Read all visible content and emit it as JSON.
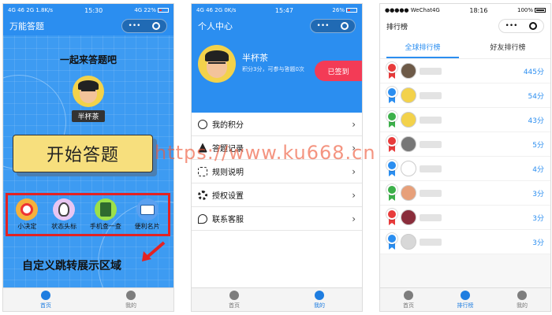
{
  "phone1": {
    "status": {
      "left": "4G 46 2G 1.8K/s",
      "time": "15:30",
      "right": "4G 22%"
    },
    "nav_title": "万能答题",
    "subtitle": "一起来答题吧",
    "nickname": "半杯茶",
    "start_label": "开始答题",
    "tools": [
      {
        "label": "小决定",
        "icon": "wheel-icon",
        "color": "#f5b13c"
      },
      {
        "label": "状态头标",
        "icon": "penguin-icon",
        "color": "#e7c6f2"
      },
      {
        "label": "手机查一查",
        "icon": "notebook-icon",
        "color": "#9be04a"
      },
      {
        "label": "便利名片",
        "icon": "card-icon",
        "color": "#5aa0f0"
      }
    ],
    "custom_text": "自定义跳转展示区域",
    "tabs": [
      {
        "label": "首页",
        "icon": "home-icon"
      },
      {
        "label": "我的",
        "icon": "user-icon"
      }
    ],
    "active_tab": 0
  },
  "phone2": {
    "status": {
      "left": "4G 46 2G 0K/s",
      "time": "15:47",
      "right": "26%"
    },
    "nav_title": "个人中心",
    "nickname": "半杯茶",
    "desc": "积分3分，可参与答题0次",
    "signed_label": "已签到",
    "menu": [
      {
        "label": "我的积分",
        "icon": "coins-icon"
      },
      {
        "label": "答题记录",
        "icon": "record-icon"
      },
      {
        "label": "规则说明",
        "icon": "rules-icon"
      },
      {
        "label": "授权设置",
        "icon": "settings-icon"
      },
      {
        "label": "联系客服",
        "icon": "service-icon"
      }
    ],
    "tabs": [
      {
        "label": "首页",
        "icon": "home-icon"
      },
      {
        "label": "我的",
        "icon": "user-icon"
      }
    ],
    "active_tab": 1
  },
  "phone3": {
    "status": {
      "left": "●●●●● WeChat4G",
      "time": "18:16",
      "right": "100%"
    },
    "nav_title": "排行榜",
    "rank_tabs": [
      "全球排行榜",
      "好友排行榜"
    ],
    "active_rank_tab": 0,
    "rows": [
      {
        "score": "445分",
        "medal": "#e83b3b",
        "avatar": "#6d5a48"
      },
      {
        "score": "54分",
        "medal": "#2b8ef0",
        "avatar": "#f3d24b"
      },
      {
        "score": "43分",
        "medal": "#3cb04a",
        "avatar": "#f3d24b"
      },
      {
        "score": "5分",
        "medal": "#e83b3b",
        "avatar": "#777777"
      },
      {
        "score": "4分",
        "medal": "#2b8ef0",
        "avatar": "#ffffff"
      },
      {
        "score": "3分",
        "medal": "#3cb04a",
        "avatar": "#e7a07a"
      },
      {
        "score": "3分",
        "medal": "#e83b3b",
        "avatar": "#8a2d3b"
      },
      {
        "score": "3分",
        "medal": "#2b8ef0",
        "avatar": "#d8d8d8"
      }
    ],
    "tabs": [
      {
        "label": "首页",
        "icon": "home-icon"
      },
      {
        "label": "排行榜",
        "icon": "rank-icon"
      },
      {
        "label": "我的",
        "icon": "user-icon"
      }
    ],
    "active_tab": 1
  },
  "watermark": "https://www.ku668.cn"
}
